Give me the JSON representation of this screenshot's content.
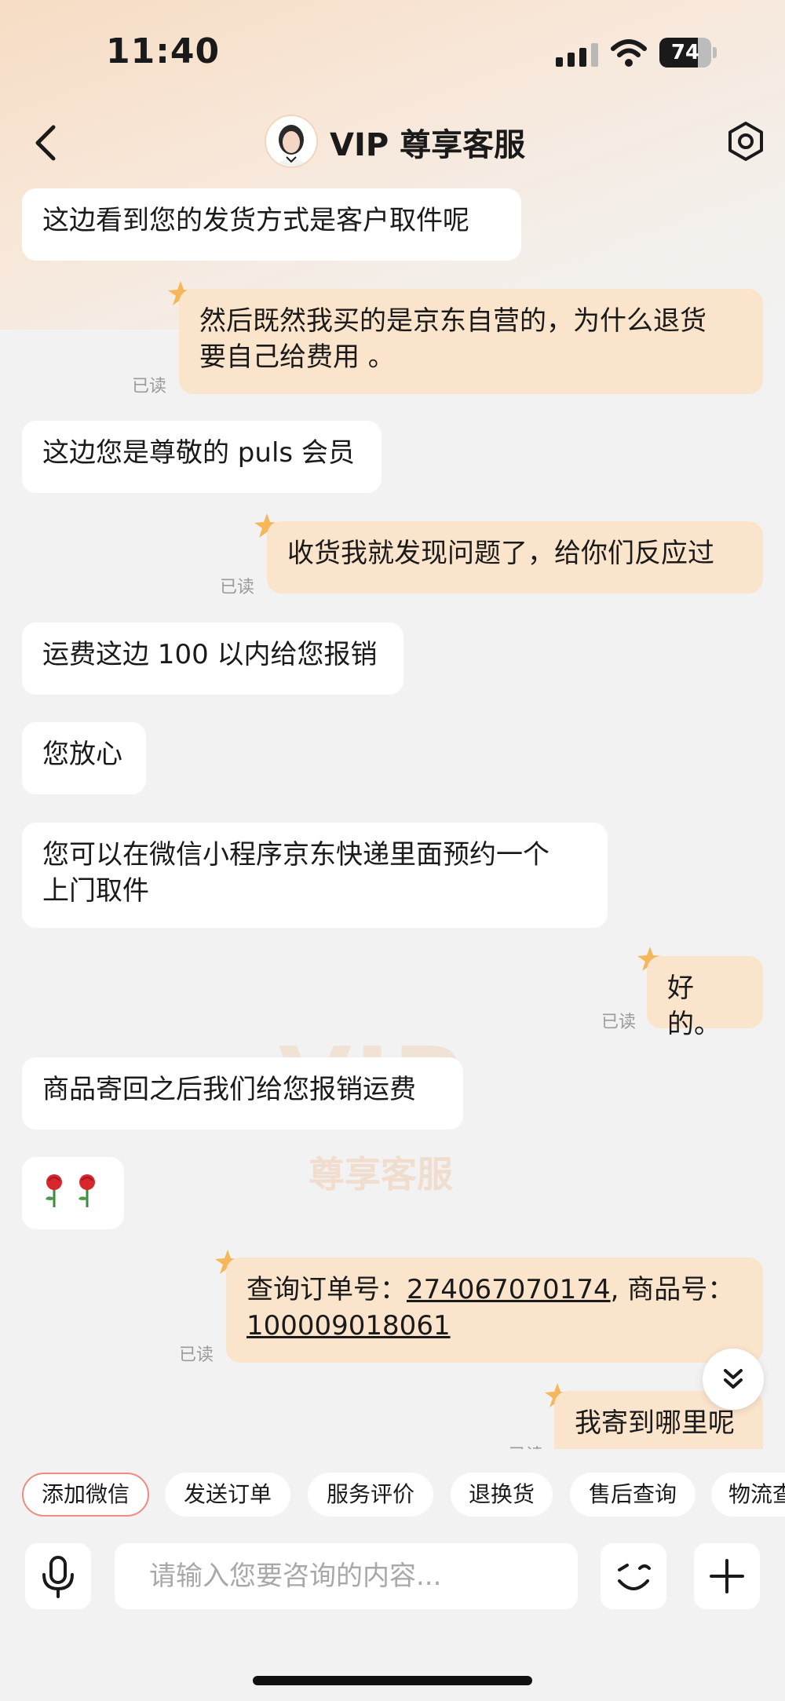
{
  "status_bar": {
    "time": "11:40",
    "battery": "74"
  },
  "header": {
    "title": "VIP 尊享客服"
  },
  "watermark": {
    "vip": "VIP",
    "text": "尊享客服"
  },
  "messages": [
    {
      "side": "left",
      "lines": [
        "这边看到您的发货方式是客户取件呢"
      ]
    },
    {
      "side": "right",
      "lines": [
        "然后既然我买的是京东自营的，为什么退货",
        "要自己给费用 。"
      ],
      "read": "已读"
    },
    {
      "side": "left",
      "lines": [
        "这边您是尊敬的 puls 会员"
      ]
    },
    {
      "side": "right",
      "lines": [
        "收货我就发现问题了，给你们反应过"
      ],
      "read": "已读"
    },
    {
      "side": "left",
      "lines": [
        "运费这边 100 以内给您报销"
      ]
    },
    {
      "side": "left",
      "lines": [
        "您放心"
      ]
    },
    {
      "side": "left",
      "lines": [
        "您可以在微信小程序京东快递里面预约一个",
        "上门取件"
      ]
    },
    {
      "side": "right",
      "lines": [
        "好的。"
      ],
      "read": "已读"
    },
    {
      "side": "left",
      "lines": [
        "商品寄回之后我们给您报销运费"
      ]
    },
    {
      "side": "left",
      "lines": [
        "🌹🌹"
      ]
    },
    {
      "side": "right",
      "order": {
        "prefix": "查询订单号：",
        "order_no": "274067070174",
        "mid": ", 商品号：",
        "product_no": "100009018061"
      },
      "read": "已读"
    },
    {
      "side": "right",
      "lines": [
        "我寄到哪里呢"
      ],
      "read": "已读"
    }
  ],
  "quick_actions": [
    "添加微信",
    "发送订单",
    "服务评价",
    "退换货",
    "售后查询",
    "物流查询"
  ],
  "input": {
    "placeholder": "请输入您要咨询的内容..."
  },
  "icons": {
    "back": "chevron-left-icon",
    "settings": "hexagon-settings-icon",
    "voice": "microphone-icon",
    "emoji": "wink-face-icon",
    "plus": "plus-icon",
    "scroll": "double-chevron-down-icon"
  },
  "colors": {
    "user_bubble": "#fbe4cc",
    "agent_bubble": "#ffffff",
    "active_chip_border": "#f08a80"
  }
}
